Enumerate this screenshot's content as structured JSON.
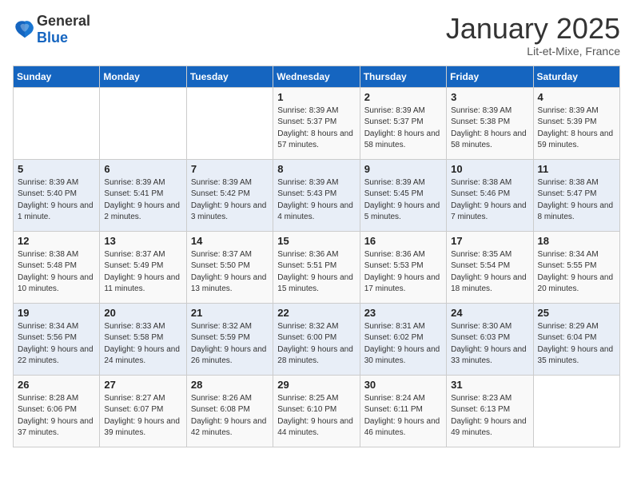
{
  "logo": {
    "general": "General",
    "blue": "Blue"
  },
  "title": "January 2025",
  "location": "Lit-et-Mixe, France",
  "headers": [
    "Sunday",
    "Monday",
    "Tuesday",
    "Wednesday",
    "Thursday",
    "Friday",
    "Saturday"
  ],
  "weeks": [
    [
      {
        "day": "",
        "info": ""
      },
      {
        "day": "",
        "info": ""
      },
      {
        "day": "",
        "info": ""
      },
      {
        "day": "1",
        "info": "Sunrise: 8:39 AM\nSunset: 5:37 PM\nDaylight: 8 hours\nand 57 minutes."
      },
      {
        "day": "2",
        "info": "Sunrise: 8:39 AM\nSunset: 5:37 PM\nDaylight: 8 hours\nand 58 minutes."
      },
      {
        "day": "3",
        "info": "Sunrise: 8:39 AM\nSunset: 5:38 PM\nDaylight: 8 hours\nand 58 minutes."
      },
      {
        "day": "4",
        "info": "Sunrise: 8:39 AM\nSunset: 5:39 PM\nDaylight: 8 hours\nand 59 minutes."
      }
    ],
    [
      {
        "day": "5",
        "info": "Sunrise: 8:39 AM\nSunset: 5:40 PM\nDaylight: 9 hours\nand 1 minute."
      },
      {
        "day": "6",
        "info": "Sunrise: 8:39 AM\nSunset: 5:41 PM\nDaylight: 9 hours\nand 2 minutes."
      },
      {
        "day": "7",
        "info": "Sunrise: 8:39 AM\nSunset: 5:42 PM\nDaylight: 9 hours\nand 3 minutes."
      },
      {
        "day": "8",
        "info": "Sunrise: 8:39 AM\nSunset: 5:43 PM\nDaylight: 9 hours\nand 4 minutes."
      },
      {
        "day": "9",
        "info": "Sunrise: 8:39 AM\nSunset: 5:45 PM\nDaylight: 9 hours\nand 5 minutes."
      },
      {
        "day": "10",
        "info": "Sunrise: 8:38 AM\nSunset: 5:46 PM\nDaylight: 9 hours\nand 7 minutes."
      },
      {
        "day": "11",
        "info": "Sunrise: 8:38 AM\nSunset: 5:47 PM\nDaylight: 9 hours\nand 8 minutes."
      }
    ],
    [
      {
        "day": "12",
        "info": "Sunrise: 8:38 AM\nSunset: 5:48 PM\nDaylight: 9 hours\nand 10 minutes."
      },
      {
        "day": "13",
        "info": "Sunrise: 8:37 AM\nSunset: 5:49 PM\nDaylight: 9 hours\nand 11 minutes."
      },
      {
        "day": "14",
        "info": "Sunrise: 8:37 AM\nSunset: 5:50 PM\nDaylight: 9 hours\nand 13 minutes."
      },
      {
        "day": "15",
        "info": "Sunrise: 8:36 AM\nSunset: 5:51 PM\nDaylight: 9 hours\nand 15 minutes."
      },
      {
        "day": "16",
        "info": "Sunrise: 8:36 AM\nSunset: 5:53 PM\nDaylight: 9 hours\nand 17 minutes."
      },
      {
        "day": "17",
        "info": "Sunrise: 8:35 AM\nSunset: 5:54 PM\nDaylight: 9 hours\nand 18 minutes."
      },
      {
        "day": "18",
        "info": "Sunrise: 8:34 AM\nSunset: 5:55 PM\nDaylight: 9 hours\nand 20 minutes."
      }
    ],
    [
      {
        "day": "19",
        "info": "Sunrise: 8:34 AM\nSunset: 5:56 PM\nDaylight: 9 hours\nand 22 minutes."
      },
      {
        "day": "20",
        "info": "Sunrise: 8:33 AM\nSunset: 5:58 PM\nDaylight: 9 hours\nand 24 minutes."
      },
      {
        "day": "21",
        "info": "Sunrise: 8:32 AM\nSunset: 5:59 PM\nDaylight: 9 hours\nand 26 minutes."
      },
      {
        "day": "22",
        "info": "Sunrise: 8:32 AM\nSunset: 6:00 PM\nDaylight: 9 hours\nand 28 minutes."
      },
      {
        "day": "23",
        "info": "Sunrise: 8:31 AM\nSunset: 6:02 PM\nDaylight: 9 hours\nand 30 minutes."
      },
      {
        "day": "24",
        "info": "Sunrise: 8:30 AM\nSunset: 6:03 PM\nDaylight: 9 hours\nand 33 minutes."
      },
      {
        "day": "25",
        "info": "Sunrise: 8:29 AM\nSunset: 6:04 PM\nDaylight: 9 hours\nand 35 minutes."
      }
    ],
    [
      {
        "day": "26",
        "info": "Sunrise: 8:28 AM\nSunset: 6:06 PM\nDaylight: 9 hours\nand 37 minutes."
      },
      {
        "day": "27",
        "info": "Sunrise: 8:27 AM\nSunset: 6:07 PM\nDaylight: 9 hours\nand 39 minutes."
      },
      {
        "day": "28",
        "info": "Sunrise: 8:26 AM\nSunset: 6:08 PM\nDaylight: 9 hours\nand 42 minutes."
      },
      {
        "day": "29",
        "info": "Sunrise: 8:25 AM\nSunset: 6:10 PM\nDaylight: 9 hours\nand 44 minutes."
      },
      {
        "day": "30",
        "info": "Sunrise: 8:24 AM\nSunset: 6:11 PM\nDaylight: 9 hours\nand 46 minutes."
      },
      {
        "day": "31",
        "info": "Sunrise: 8:23 AM\nSunset: 6:13 PM\nDaylight: 9 hours\nand 49 minutes."
      },
      {
        "day": "",
        "info": ""
      }
    ]
  ]
}
